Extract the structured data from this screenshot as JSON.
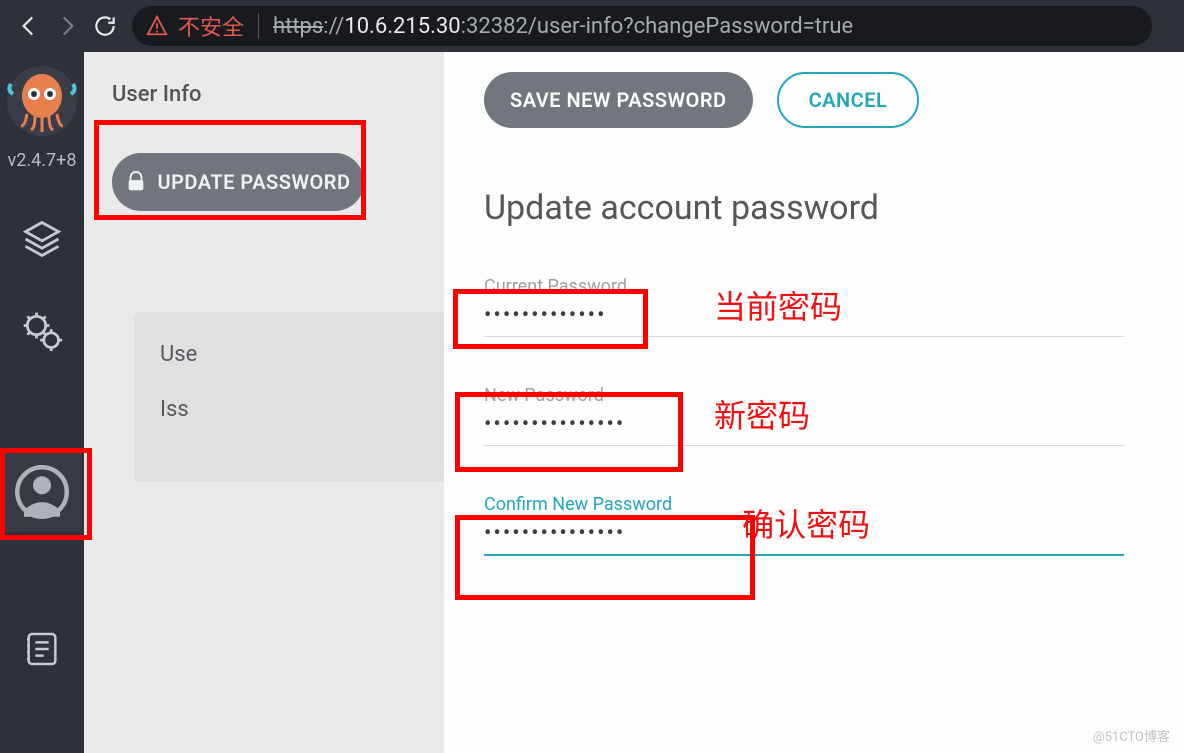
{
  "browser": {
    "insecure_label": "不安全",
    "scheme": "https",
    "host": "10.6.215.30",
    "port": ":32382",
    "path": "/user-info?changePassword=true"
  },
  "sidebar": {
    "version": "v2.4.7+8"
  },
  "back_panel": {
    "title": "User Info",
    "update_btn": "UPDATE PASSWORD",
    "card_line1": "Use",
    "card_line2": "Iss"
  },
  "front_panel": {
    "save_label": "SAVE NEW PASSWORD",
    "cancel_label": "CANCEL",
    "heading": "Update account password",
    "fields": {
      "current": {
        "label": "Current Password",
        "value": "•••••••••••••"
      },
      "new": {
        "label": "New Password",
        "value": "•••••••••••••••"
      },
      "confirm": {
        "label": "Confirm New Password",
        "value": "•••••••••••••••"
      }
    },
    "annotations": {
      "current": "当前密码",
      "new": "新密码",
      "confirm": "确认密码"
    }
  },
  "watermark": "@51CTO博客"
}
